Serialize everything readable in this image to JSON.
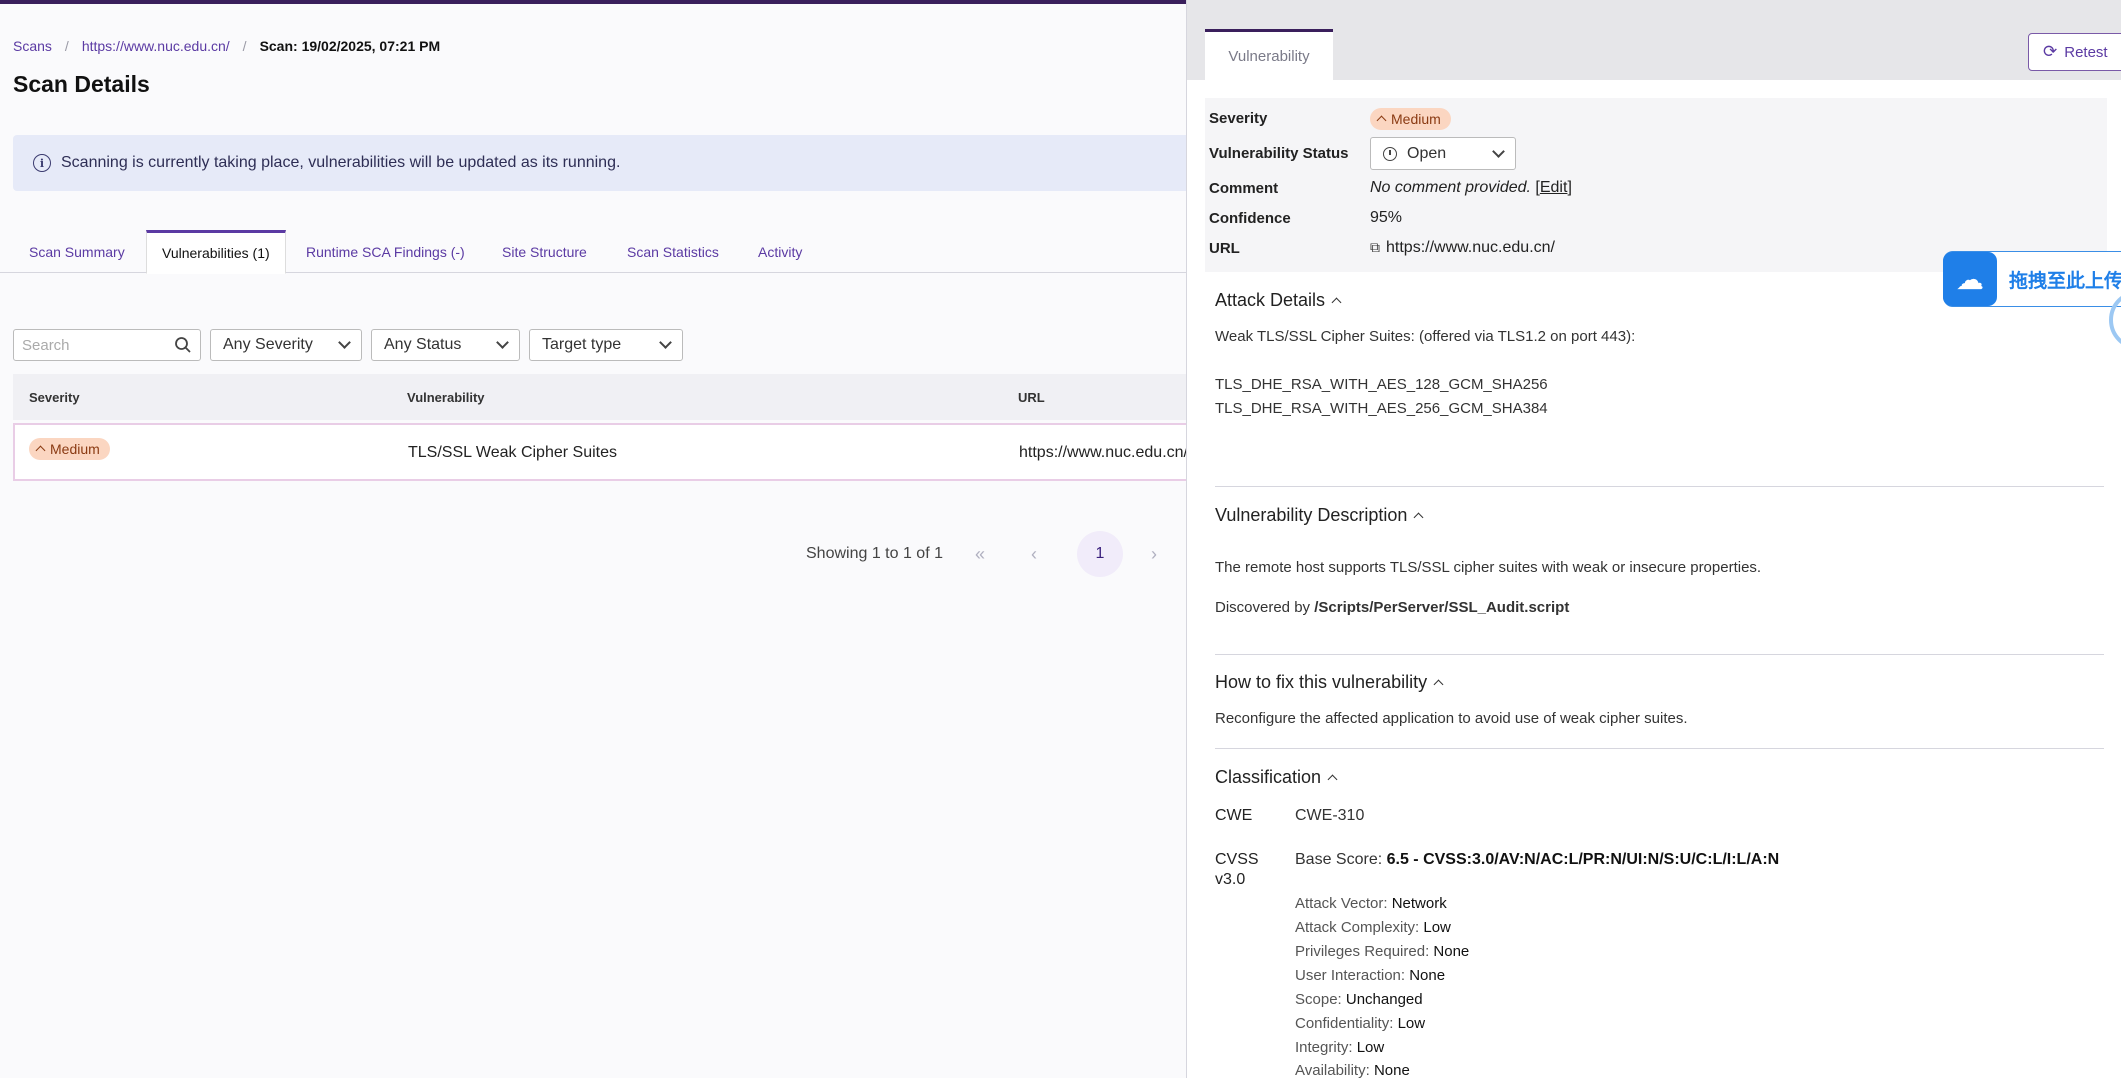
{
  "breadcrumb": {
    "scans": "Scans",
    "site": "https://www.nuc.edu.cn/",
    "current": "Scan: 19/02/2025, 07:21 PM"
  },
  "page_title": "Scan Details",
  "banner": {
    "icon": "info-icon",
    "text": "Scanning is currently taking place, vulnerabilities will be updated as its running."
  },
  "tabs": [
    {
      "label": "Scan Summary"
    },
    {
      "label": "Vulnerabilities (1)"
    },
    {
      "label": "Runtime SCA Findings (-)"
    },
    {
      "label": "Site Structure"
    },
    {
      "label": "Scan Statistics"
    },
    {
      "label": "Activity"
    }
  ],
  "filters": {
    "search_placeholder": "Search",
    "severity": "Any Severity",
    "status": "Any Status",
    "target_type": "Target type"
  },
  "table": {
    "columns": [
      "Severity",
      "Vulnerability",
      "URL"
    ],
    "rows": [
      {
        "severity": "Medium",
        "vulnerability": "TLS/SSL Weak Cipher Suites",
        "url": "https://www.nuc.edu.cn/"
      }
    ]
  },
  "pagination": {
    "summary": "Showing 1 to 1 of 1",
    "first": "«",
    "prev": "‹",
    "page": "1",
    "next": "›"
  },
  "detail": {
    "tab": "Vulnerability",
    "retest_label": "Retest",
    "severity_label": "Severity",
    "severity_value": "Medium",
    "status_label": "Vulnerability Status",
    "status_value": "Open",
    "comment_label": "Comment",
    "comment_value": "No comment provided.",
    "comment_edit_open": " [",
    "comment_edit": "Edit",
    "comment_edit_close": "]",
    "confidence_label": "Confidence",
    "confidence_value": "95%",
    "url_label": "URL",
    "url_value": "https://www.nuc.edu.cn/",
    "attack_details": {
      "title": "Attack Details",
      "line1": "Weak TLS/SSL Cipher Suites: (offered via TLS1.2 on port 443):",
      "line2": "TLS_DHE_RSA_WITH_AES_128_GCM_SHA256",
      "line3": "TLS_DHE_RSA_WITH_AES_256_GCM_SHA384"
    },
    "description": {
      "title": "Vulnerability Description",
      "text": "The remote host supports TLS/SSL cipher suites with weak or insecure properties.",
      "discovered_prefix": "Discovered by ",
      "discovered_script": "/Scripts/PerServer/SSL_Audit.script"
    },
    "fix": {
      "title": "How to fix this vulnerability",
      "text": "Reconfigure the affected application to avoid use of weak cipher suites."
    },
    "classification": {
      "title": "Classification",
      "cwe_label": "CWE",
      "cwe_value": "CWE-310",
      "cvss_label_1": "CVSS",
      "cvss_label_2": "v3.0",
      "base_score_label": "Base Score: ",
      "base_score_value": "6.5 - CVSS:3.0/AV:N/AC:L/PR:N/UI:N/S:U/C:L/I:L/A:N",
      "metrics": [
        {
          "label": "Attack Vector: ",
          "value": "Network"
        },
        {
          "label": "Attack Complexity: ",
          "value": "Low"
        },
        {
          "label": "Privileges Required: ",
          "value": "None"
        },
        {
          "label": "User Interaction: ",
          "value": "None"
        },
        {
          "label": "Scope: ",
          "value": "Unchanged"
        },
        {
          "label": "Confidentiality: ",
          "value": "Low"
        },
        {
          "label": "Integrity: ",
          "value": "Low"
        },
        {
          "label": "Availability: ",
          "value": "None"
        }
      ]
    }
  },
  "upload_widget": {
    "text": "拖拽至此上传"
  },
  "colors": {
    "accent": "#5b3aa3",
    "medium_badge_bg": "#fbd6c1",
    "banner_bg": "#e6eaf8"
  }
}
